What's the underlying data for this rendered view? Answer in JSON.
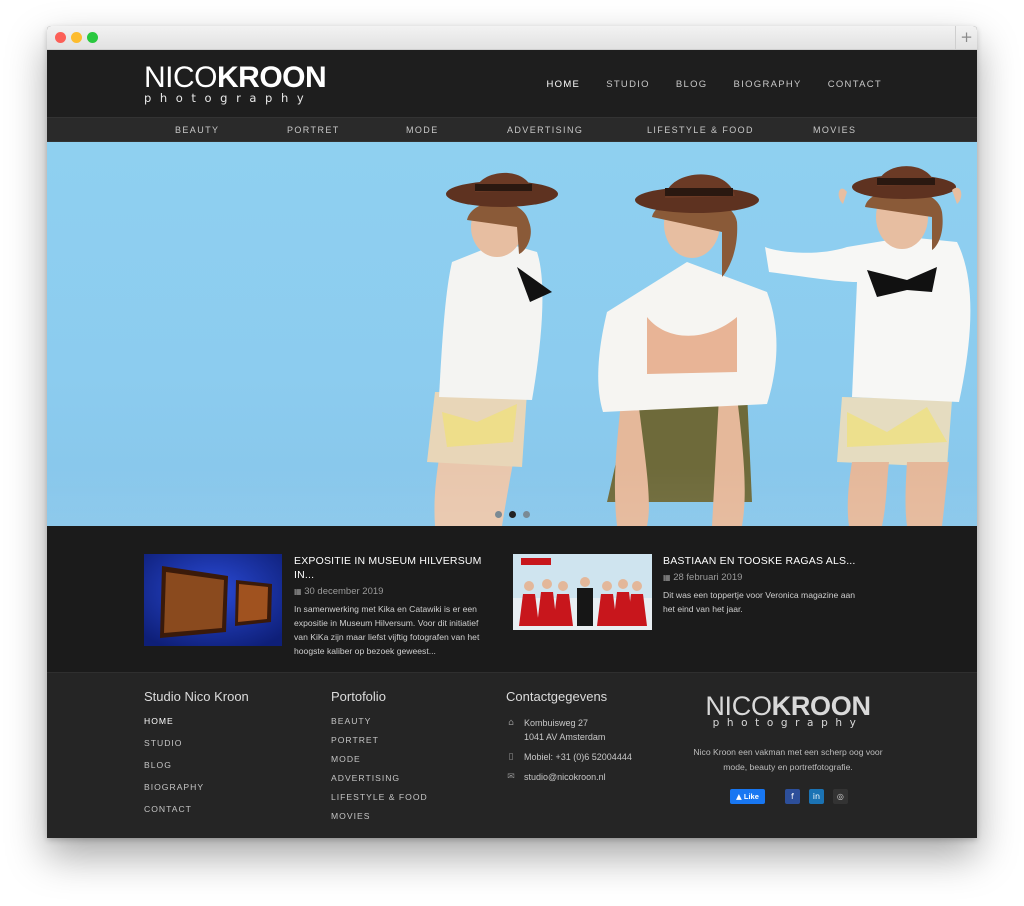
{
  "brand": {
    "name_light": "NICO",
    "name_bold": "KROON",
    "sub": "photography"
  },
  "main_nav": [
    {
      "label": "HOME",
      "active": true
    },
    {
      "label": "STUDIO",
      "active": false
    },
    {
      "label": "BLOG",
      "active": false
    },
    {
      "label": "BIOGRAPHY",
      "active": false
    },
    {
      "label": "CONTACT",
      "active": false
    }
  ],
  "sub_nav": [
    "BEAUTY",
    "PORTRET",
    "MODE",
    "ADVERTISING",
    "LIFESTYLE & FOOD",
    "MOVIES"
  ],
  "slider": {
    "slides": 3,
    "active_index": 1
  },
  "posts": [
    {
      "title": "EXPOSITIE IN MUSEUM HILVERSUM IN...",
      "date": "30 december 2019",
      "excerpt": "In samenwerking met Kika en Catawiki is er een expositie in Museum Hilversum. Voor dit initiatief van KiKa zijn maar liefst vijftig fotografen van het hoogste kaliber op bezoek geweest..."
    },
    {
      "title": "BASTIAAN EN TOOSKE RAGAS ALS...",
      "date": "28 februari 2019",
      "excerpt": "Dit was een toppertje voor Veronica magazine aan het eind van het jaar."
    }
  ],
  "footer": {
    "studio": {
      "heading": "Studio Nico Kroon",
      "links": [
        {
          "label": "HOME",
          "active": true
        },
        {
          "label": "STUDIO",
          "active": false
        },
        {
          "label": "BLOG",
          "active": false
        },
        {
          "label": "BIOGRAPHY",
          "active": false
        },
        {
          "label": "CONTACT",
          "active": false
        }
      ]
    },
    "portfolio": {
      "heading": "Portofolio",
      "links": [
        "BEAUTY",
        "PORTRET",
        "MODE",
        "ADVERTISING",
        "LIFESTYLE & FOOD",
        "MOVIES"
      ]
    },
    "contact": {
      "heading": "Contactgegevens",
      "address_line1": "Kombuisweg 27",
      "address_line2": "1041 AV Amsterdam",
      "phone": "Mobiel: +31 (0)6 52004444",
      "email": "studio@nicokroon.nl"
    },
    "about": {
      "tagline": "Nico Kroon een vakman met een scherp oog voor mode, beauty en portretfotografie.",
      "like_label": "Like"
    }
  },
  "colors": {
    "background": "#1e1e1e",
    "sky": "#8fd0f0",
    "facebook": "#1877f2",
    "linkedin": "#1b73b4"
  },
  "icons": [
    "home-icon",
    "phone-icon",
    "mail-icon",
    "calendar-icon",
    "facebook-icon",
    "linkedin-icon",
    "instagram-icon",
    "thumbs-up-icon"
  ]
}
